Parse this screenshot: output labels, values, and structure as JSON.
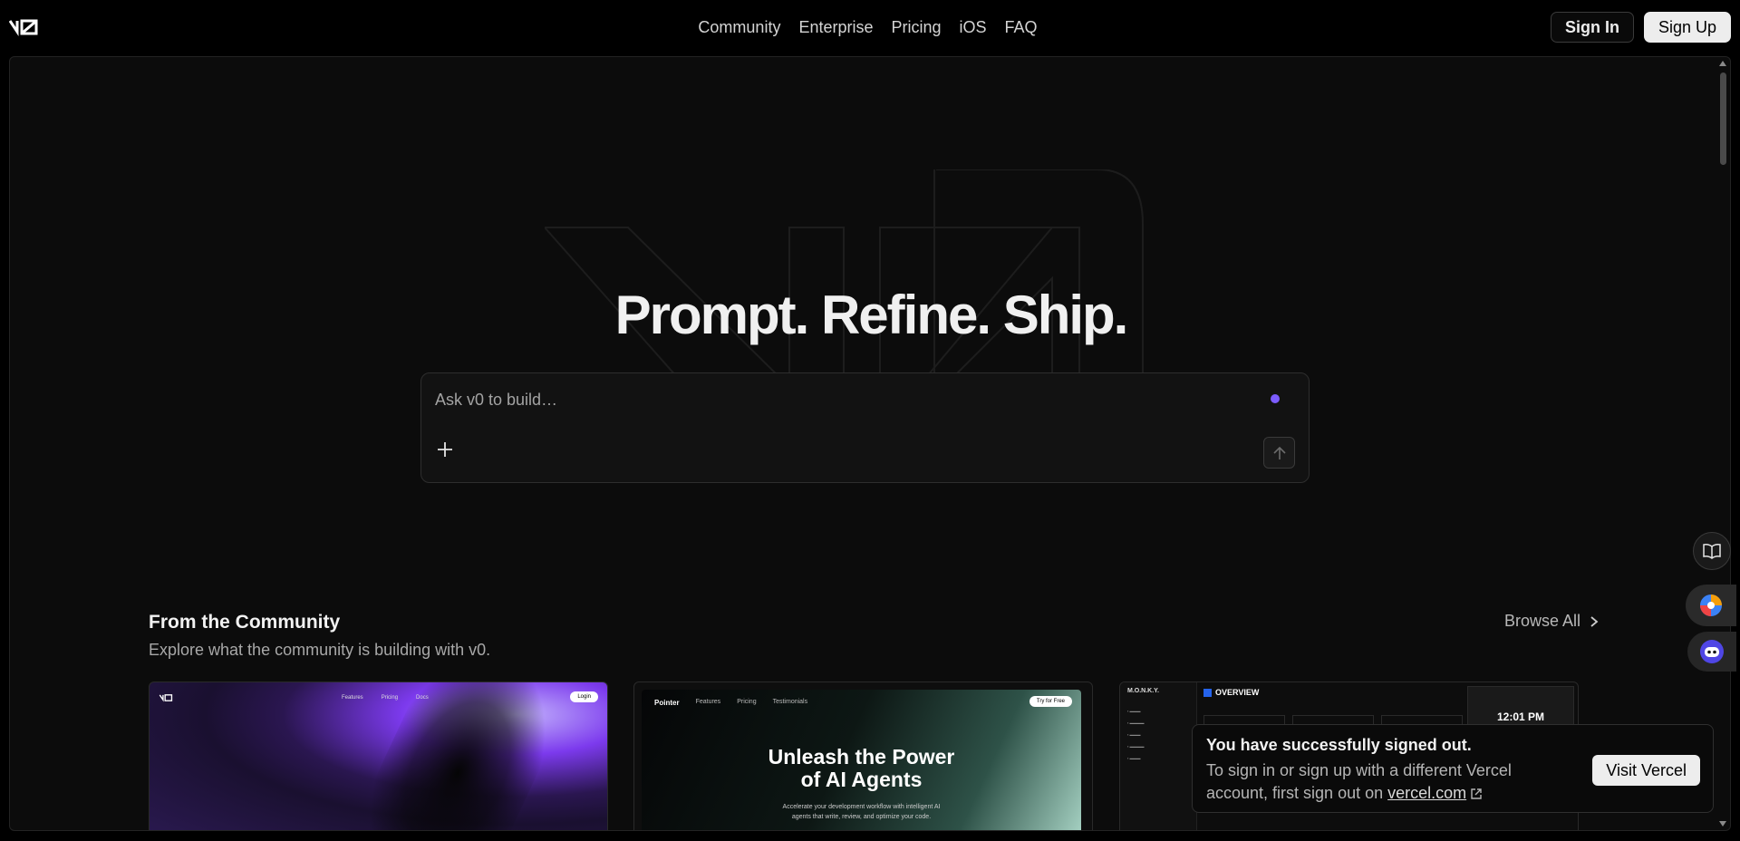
{
  "nav": {
    "links": [
      "Community",
      "Enterprise",
      "Pricing",
      "iOS",
      "FAQ"
    ],
    "sign_in": "Sign In",
    "sign_up": "Sign Up"
  },
  "hero": {
    "headline": "Prompt. Refine. Ship.",
    "prompt_placeholder": "Ask v0 to build…"
  },
  "community": {
    "title": "From the Community",
    "subtitle": "Explore what the community is building with v0.",
    "browse_all": "Browse All",
    "cards": [
      {
        "nav_links": [
          "Features",
          "Pricing",
          "Docs"
        ],
        "login": "Login"
      },
      {
        "brand": "Pointer",
        "nav_links": [
          "Features",
          "Pricing",
          "Testimonials"
        ],
        "cta": "Try for Free",
        "title_line1": "Unleash the Power",
        "title_line2": "of AI Agents",
        "desc_line1": "Accelerate your development workflow with intelligent AI",
        "desc_line2": "agents that write, review, and optimize your code."
      },
      {
        "brand": "M.O.N.K.Y.",
        "heading": "OVERVIEW",
        "clock": "12:01 PM"
      }
    ]
  },
  "toast": {
    "title": "You have successfully signed out.",
    "body": "To sign in or sign up with a different Vercel account, first sign out on",
    "link": "vercel.com",
    "button": "Visit  Vercel"
  },
  "colors": {
    "accent_dot": "#7c5cff",
    "background": "#000000",
    "frame": "#0c0c0c"
  },
  "icons": [
    "v0-logo-icon",
    "plus-icon",
    "arrow-up-icon",
    "chevron-right-icon",
    "external-link-icon",
    "book-icon",
    "extension-icon",
    "assistant-icon"
  ]
}
